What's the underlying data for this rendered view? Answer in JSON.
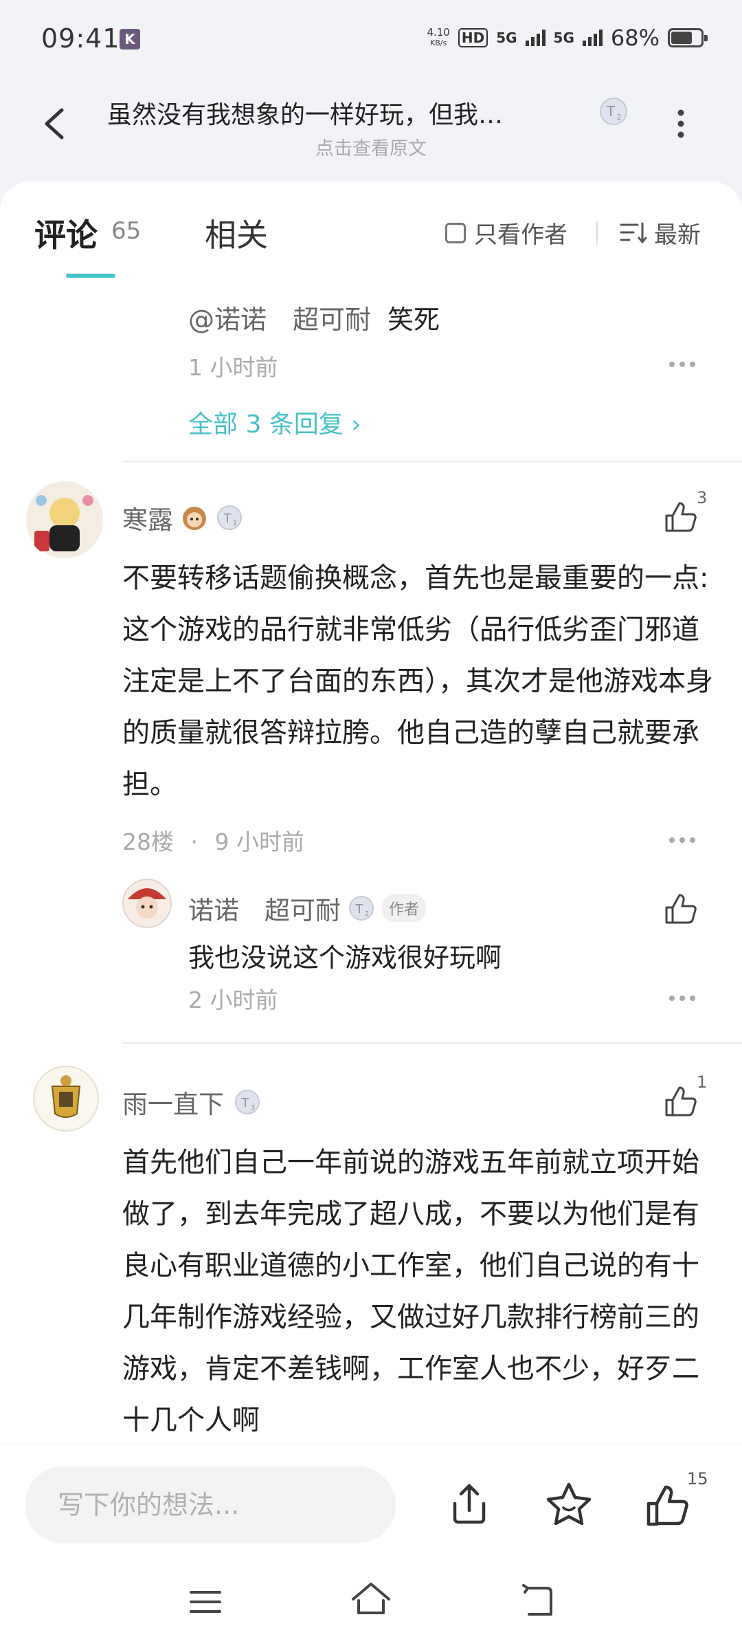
{
  "status_bar": {
    "time": "09:41",
    "app_badge": "K",
    "net_speed": "4.10",
    "net_speed_unit": "KB/s",
    "hd": "HD",
    "net1": "5G",
    "net2": "5G",
    "battery_percent": "68%",
    "battery_level": 0.68
  },
  "header": {
    "title": "虽然没有我想象的一样好玩，但我…",
    "subtitle": "点击查看原文",
    "level_badge": "T2"
  },
  "tabs": {
    "comments_label": "评论",
    "comments_count": "65",
    "related_label": "相关",
    "author_only_label": "只看作者",
    "sort_label": "最新"
  },
  "prev_reply": {
    "text_mention": "@诺诺　超可耐",
    "text": "笑死",
    "time": "1 小时前",
    "view_all": "全部 3 条回复 ›"
  },
  "comments": [
    {
      "author": "寒露",
      "level": "T1",
      "like_count": "3",
      "text": "不要转移话题偷换概念，首先也是最重要的一点:这个游戏的品行就非常低劣（品行低劣歪门邪道注定是上不了台面的东西），其次才是他游戏本身的质量就很答辩拉胯。他自己造的孽自己就要承担。",
      "floor": "28楼",
      "separator": "·",
      "time": "9 小时前",
      "reply": {
        "author": "诺诺　超可耐",
        "level": "T2",
        "tag": "作者",
        "text": "我也没说这个游戏很好玩啊",
        "time": "2 小时前"
      }
    },
    {
      "author": "雨一直下",
      "level": "T3",
      "like_count": "1",
      "text": "首先他们自己一年前说的游戏五年前就立项开始做了，到去年完成了超八成，不要以为他们是有良心有职业道德的小工作室，他们自己说的有十几年制作游戏经验，又做过好几款排行榜前三的游戏，肯定不差钱啊，工作室人也不少，好歹二十几个人啊"
    }
  ],
  "bottom": {
    "input_placeholder": "写下你的想法...",
    "like_count": "15"
  },
  "colors": {
    "accent": "#46c2c9",
    "text_primary": "#222222",
    "text_secondary": "#aaaaaa",
    "header_bg": "#f1f3f7"
  }
}
